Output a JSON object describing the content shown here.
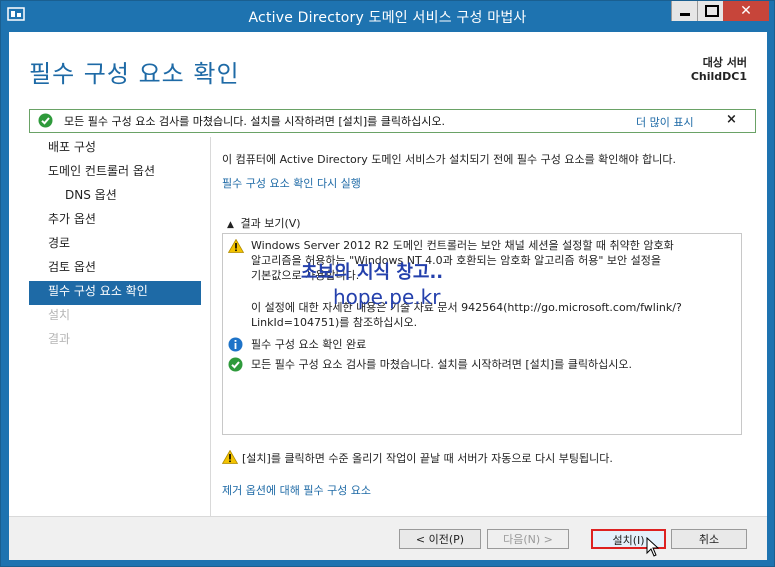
{
  "window": {
    "title": "Active Directory 도메인 서비스 구성 마법사"
  },
  "header": {
    "page_title": "필수 구성 요소 확인",
    "target_label": "대상 서버",
    "target_name": "ChildDC1"
  },
  "notification": {
    "message": "모든 필수 구성 요소 검사를 마쳤습니다. 설치를 시작하려면 [설치]를 클릭하십시오.",
    "more_link": "더 많이 표시",
    "close": "×"
  },
  "nav": {
    "items": [
      {
        "label": "배포 구성"
      },
      {
        "label": "도메인 컨트롤러 옵션"
      },
      {
        "label": "DNS 옵션"
      },
      {
        "label": "추가 옵션"
      },
      {
        "label": "경로"
      },
      {
        "label": "검토 옵션"
      },
      {
        "label": "필수 구성 요소 확인"
      },
      {
        "label": "설치"
      },
      {
        "label": "결과"
      }
    ]
  },
  "content": {
    "intro": "이 컴퓨터에 Active Directory 도메인 서비스가 설치되기 전에 필수 구성 요소를 확인해야 합니다.",
    "rerun_link": "필수 구성 요소 확인 다시 실행",
    "results_toggle": "결과 보기(V)",
    "results": {
      "warning_line1": "Windows Server 2012 R2 도메인 컨트롤러는 보안 채널 세션을 설정할 때 취약한 암호화",
      "warning_line2": "알고리즘을 허용하는 \"Windows NT 4.0과 호환되는 암호화 알고리즘 허용\" 보안 설정을",
      "warning_line3": "기본값으로 사용합니다.",
      "warning_line4": "이 설정에 대한 자세한 내용은 기술 자료 문서 942564(http://go.microsoft.com/fwlink/?",
      "warning_line5": "LinkId=104751)를 참조하십시오.",
      "info_line": "필수 구성 요소 확인 완료",
      "ok_line": "모든 필수 구성 요소 검사를 마쳤습니다. 설치를 시작하려면 [설치]를 클릭하십시오."
    },
    "bottom_warning": "[설치]를 클릭하면 수준 올리기 작업이 끝날 때 서버가 자동으로 다시 부팅됩니다.",
    "more_link": "제거 옵션에 대해 필수 구성 요소"
  },
  "watermark": {
    "line1": "초보의 지식 창고..",
    "line2": "hope.pe.kr"
  },
  "footer": {
    "prev": "< 이전(P)",
    "next": "다음(N) >",
    "install": "설치(I)",
    "cancel": "취소"
  },
  "colors": {
    "accent": "#1e6aa6",
    "titlebar": "#1e73b0",
    "close": "#c7453a",
    "highlight_border": "#dd2222"
  }
}
